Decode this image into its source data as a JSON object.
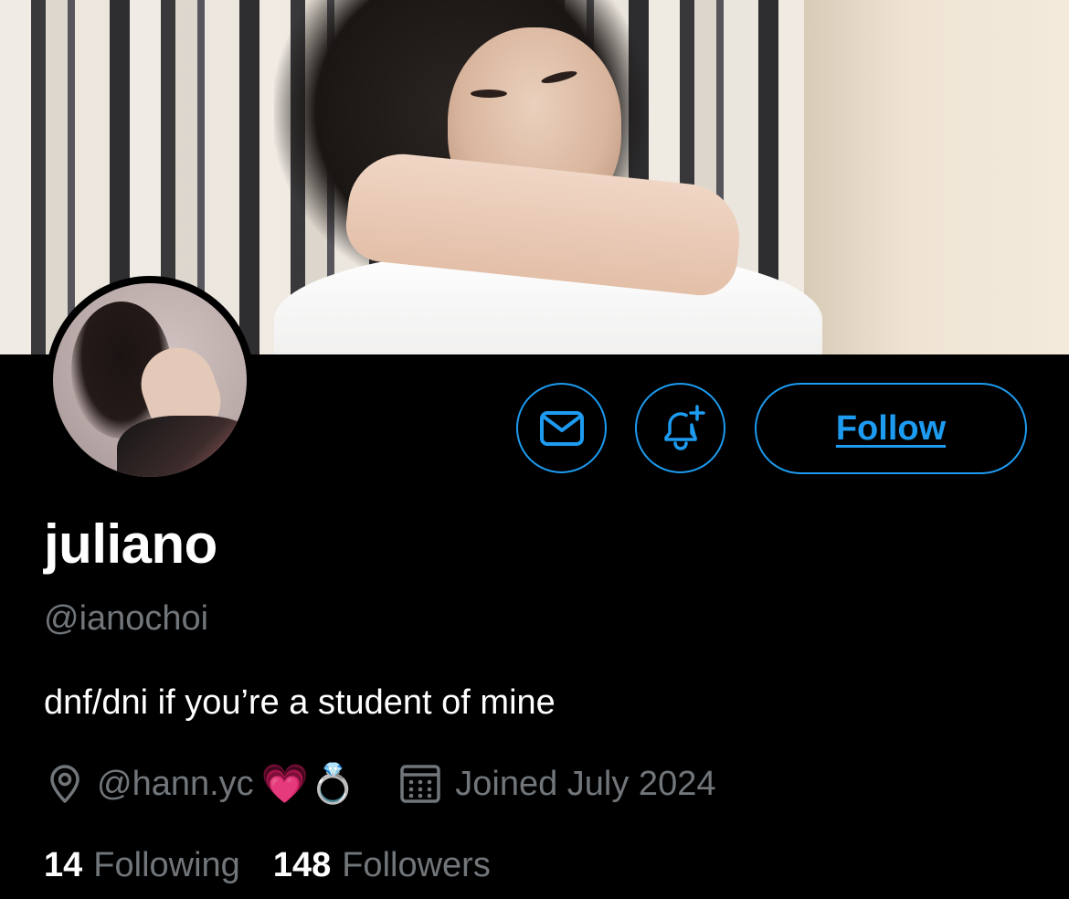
{
  "profile": {
    "display_name": "juliano",
    "handle": "@ianochoi",
    "bio": "dnf/dni if you’re a student of mine",
    "location": "@hann.yc",
    "location_emojis": "💗💍",
    "joined": "Joined July 2024"
  },
  "actions": {
    "message_icon": "envelope-icon",
    "notify_icon": "bell-plus-icon",
    "follow_label": "Follow"
  },
  "stats": {
    "following_count": "14",
    "following_label": "Following",
    "followers_count": "148",
    "followers_label": "Followers"
  },
  "colors": {
    "accent": "#1d9bf0",
    "background": "#000000",
    "secondary_text": "#71767b",
    "primary_text": "#ffffff"
  }
}
